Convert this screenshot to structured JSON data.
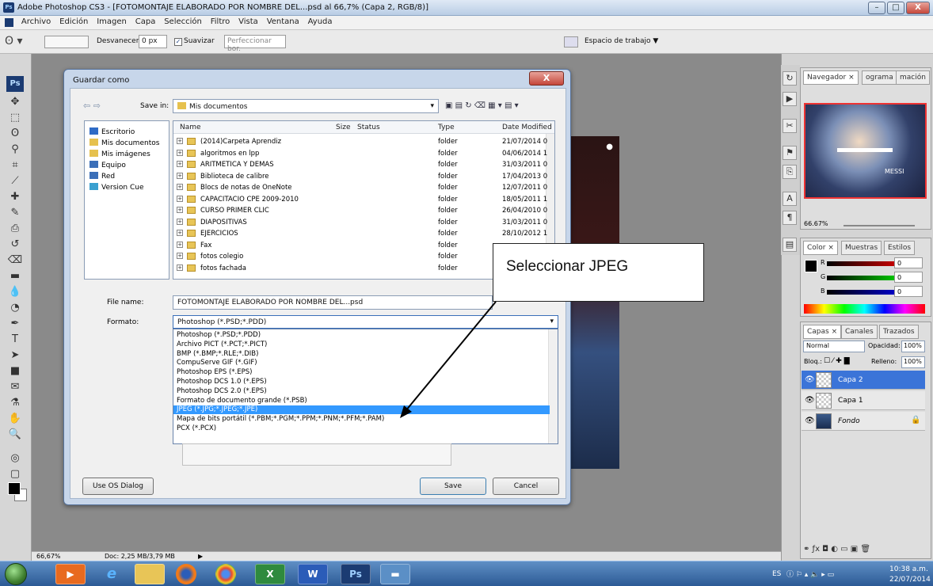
{
  "window": {
    "badge": "Ps",
    "title": "Adobe Photoshop CS3 - [FOTOMONTAJE ELABORADO POR NOMBRE DEL...psd al 66,7% (Capa 2, RGB/8)]",
    "min": "–",
    "max": "□",
    "close": "X"
  },
  "menu": {
    "items": [
      "Archivo",
      "Edición",
      "Imagen",
      "Capa",
      "Selección",
      "Filtro",
      "Vista",
      "Ventana",
      "Ayuda"
    ]
  },
  "options": {
    "feather_label": "Desvanecer:",
    "feather_value": "0 px",
    "smooth_label": "Suavizar",
    "refine_label": "Perfeccionar bor.",
    "workspace_label": "Espacio de trabajo ▼"
  },
  "tools": {
    "ps_logo": "Ps",
    "icons": [
      "move-icon",
      "marquee-icon",
      "lasso-icon",
      "magic-wand-icon",
      "crop-icon",
      "slice-icon",
      "healing-icon",
      "brush-icon",
      "stamp-icon",
      "history-brush-icon",
      "eraser-icon",
      "gradient-icon",
      "blur-icon",
      "dodge-icon",
      "pen-icon",
      "type-icon",
      "path-select-icon",
      "shape-icon",
      "notes-icon",
      "eyedropper-icon",
      "hand-icon",
      "zoom-icon"
    ],
    "glyphs": [
      "✥",
      "⬚",
      "ʘ",
      "⚲",
      "⌗",
      "⟋",
      "✚",
      "✎",
      "⎙",
      "↺",
      "⌫",
      "▬",
      "💧",
      "◔",
      "✒",
      "T",
      "➤",
      "■",
      "✉",
      "⚗",
      "✋",
      "🔍"
    ]
  },
  "status": {
    "zoom": "66,67%",
    "doc": "Doc: 2,25 MB/3,79 MB"
  },
  "dialog": {
    "title": "Guardar como",
    "close": "X",
    "save_in_label": "Save in:",
    "save_in_value": "Mis documentos",
    "places": [
      "Escritorio",
      "Mis documentos",
      "Mis imágenes",
      "Equipo",
      "Red",
      "Version Cue"
    ],
    "place_colors": [
      "#2f6bc6",
      "#e6c14e",
      "#e6c14e",
      "#3b6fb8",
      "#3b6fb8",
      "#3aa0d0"
    ],
    "columns": {
      "name": "Name",
      "size": "Size",
      "status": "Status",
      "type": "Type",
      "date": "Date Modified"
    },
    "files": [
      {
        "name": "(2014)Carpeta Aprendiz",
        "type": "folder",
        "date": "21/07/2014 0"
      },
      {
        "name": "algoritmos en lpp",
        "type": "folder",
        "date": "04/06/2014 1"
      },
      {
        "name": "ARITMETICA Y DEMAS",
        "type": "folder",
        "date": "31/03/2011 0"
      },
      {
        "name": "Biblioteca de calibre",
        "type": "folder",
        "date": "17/04/2013 0"
      },
      {
        "name": "Blocs de notas de OneNote",
        "type": "folder",
        "date": "12/07/2011 0"
      },
      {
        "name": "CAPACITACIO CPE 2009-2010",
        "type": "folder",
        "date": "18/05/2011 1"
      },
      {
        "name": "CURSO PRIMER CLIC",
        "type": "folder",
        "date": "26/04/2010 0"
      },
      {
        "name": "DIAPOSITIVAS",
        "type": "folder",
        "date": "31/03/2011 0"
      },
      {
        "name": "EJERCICIOS",
        "type": "folder",
        "date": "28/10/2012 1"
      },
      {
        "name": "Fax",
        "type": "folder",
        "date": ""
      },
      {
        "name": "fotos colegio",
        "type": "folder",
        "date": ""
      },
      {
        "name": "fotos fachada",
        "type": "folder",
        "date": ""
      }
    ],
    "filename_label": "File name:",
    "filename_value": "FOTOMONTAJE ELABORADO POR NOMBRE DEL...psd",
    "format_label": "Formato:",
    "format_value": "Photoshop (*.PSD;*.PDD)",
    "formats": [
      "Photoshop (*.PSD;*.PDD)",
      "Archivo PICT (*.PCT;*.PICT)",
      "BMP (*.BMP;*.RLE;*.DIB)",
      "CompuServe GIF (*.GIF)",
      "Photoshop EPS (*.EPS)",
      "Photoshop DCS 1.0 (*.EPS)",
      "Photoshop DCS 2.0 (*.EPS)",
      "Formato de documento grande (*.PSB)",
      "JPEG (*.JPG;*.JPEG;*.JPE)",
      "Mapa de bits portátil (*.PBM;*.PGM;*.PPM;*.PNM;*.PFM;*.PAM)",
      "PCX (*.PCX)"
    ],
    "selected_format_index": 8,
    "os_dialog_button": "Use OS Dialog",
    "save_button": "Save",
    "cancel_button": "Cancel"
  },
  "callout": {
    "text": "Seleccionar JPEG"
  },
  "navigator": {
    "tabs": [
      "Navegador ×",
      "ograma",
      "mación"
    ],
    "zoom": "66.67%",
    "thumb_text": "MESSI"
  },
  "color": {
    "tabs": [
      "Color ×",
      "Muestras",
      "Estilos"
    ],
    "r_label": "R",
    "g_label": "G",
    "b_label": "B",
    "r": "0",
    "g": "0",
    "b": "0"
  },
  "layers": {
    "tabs": [
      "Capas ×",
      "Canales",
      "Trazados"
    ],
    "blend_mode": "Normal",
    "opacity_label": "Opacidad:",
    "opacity": "100%",
    "lock_label": "Bloq.:",
    "fill_label": "Relleno:",
    "fill": "100%",
    "items": [
      {
        "name": "Capa 2",
        "selected": true
      },
      {
        "name": "Capa 1",
        "selected": false
      },
      {
        "name": "Fondo",
        "selected": false
      }
    ]
  },
  "taskbar": {
    "ps_label": "Ps",
    "lang": "ES",
    "time": "10:38 a.m.",
    "date": "22/07/2014"
  }
}
